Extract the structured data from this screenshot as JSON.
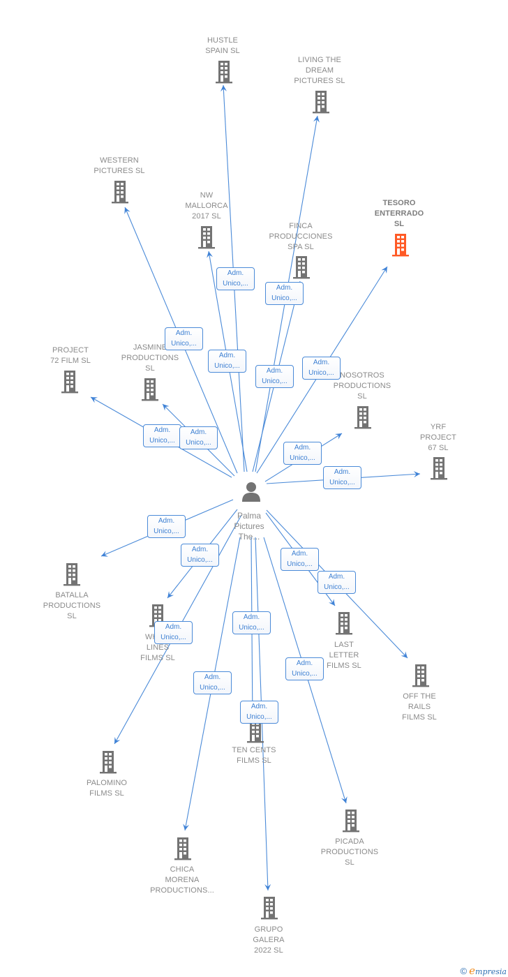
{
  "center": {
    "id": "palma",
    "label": "Palma\nPictures\nThe...",
    "icon": "person-icon"
  },
  "colors": {
    "edge": "#4a8ad8",
    "node": "#737373",
    "highlight": "#ff5a26",
    "label": "#8a8a8a"
  },
  "edge_label": "Adm.\nUnico,...",
  "nodes": [
    {
      "id": "hustle",
      "label": "HUSTLE\nSPAIN  SL",
      "icon": "building-icon",
      "highlight": false
    },
    {
      "id": "living",
      "label": "LIVING THE\nDREAM\nPICTURES  SL",
      "icon": "building-icon",
      "highlight": false
    },
    {
      "id": "western",
      "label": "WESTERN\nPICTURES  SL",
      "icon": "building-icon",
      "highlight": false
    },
    {
      "id": "nw",
      "label": "NW\nMALLORCA\n2017  SL",
      "icon": "building-icon",
      "highlight": false
    },
    {
      "id": "finca",
      "label": "FINCA\nPRODUCCIONES\nSPA  SL",
      "icon": "building-icon",
      "highlight": false
    },
    {
      "id": "tesoro",
      "label": "TESORO\nENTERRADO\nSL",
      "icon": "building-icon",
      "highlight": true
    },
    {
      "id": "project72",
      "label": "PROJECT\n72 FILM  SL",
      "icon": "building-icon",
      "highlight": false
    },
    {
      "id": "jasmine",
      "label": "JASMINE\nPRODUCTIONS\nSL",
      "icon": "building-icon",
      "highlight": false
    },
    {
      "id": "nosotros",
      "label": "NOSOTROS\nPRODUCTIONS\nSL",
      "icon": "building-icon",
      "highlight": false
    },
    {
      "id": "yrf",
      "label": "YRF\nPROJECT\n67  SL",
      "icon": "building-icon",
      "highlight": false
    },
    {
      "id": "batalla",
      "label": "BATALLA\nPRODUCTIONS\nSL",
      "icon": "building-icon",
      "highlight": false
    },
    {
      "id": "white",
      "label": "WHITE\nLINES\nFILMS  SL",
      "icon": "building-icon",
      "highlight": false
    },
    {
      "id": "last",
      "label": "LAST\nLETTER\nFILMS  SL",
      "icon": "building-icon",
      "highlight": false
    },
    {
      "id": "offrails",
      "label": "OFF THE\nRAILS\nFILMS  SL",
      "icon": "building-icon",
      "highlight": false
    },
    {
      "id": "tencents",
      "label": "TEN CENTS\nFILMS  SL",
      "icon": "building-icon",
      "highlight": false
    },
    {
      "id": "palomino",
      "label": "PALOMINO\nFILMS  SL",
      "icon": "building-icon",
      "highlight": false
    },
    {
      "id": "picada",
      "label": "PICADA\nPRODUCTIONS\nSL",
      "icon": "building-icon",
      "highlight": false
    },
    {
      "id": "chica",
      "label": "CHICA\nMORENA\nPRODUCTIONS...",
      "icon": "building-icon",
      "highlight": false
    },
    {
      "id": "grupo",
      "label": "GRUPO\nGALERA\n2022  SL",
      "icon": "building-icon",
      "highlight": false
    }
  ],
  "edges": [
    {
      "from": "palma",
      "to": "hustle",
      "label": "Adm.\nUnico,..."
    },
    {
      "from": "palma",
      "to": "living",
      "label": "Adm.\nUnico,..."
    },
    {
      "from": "palma",
      "to": "western",
      "label": "Adm.\nUnico,..."
    },
    {
      "from": "palma",
      "to": "nw",
      "label": "Adm.\nUnico,..."
    },
    {
      "from": "palma",
      "to": "finca",
      "label": "Adm.\nUnico,..."
    },
    {
      "from": "palma",
      "to": "tesoro",
      "label": "Adm.\nUnico,..."
    },
    {
      "from": "palma",
      "to": "project72",
      "label": "Adm.\nUnico,..."
    },
    {
      "from": "palma",
      "to": "jasmine",
      "label": "Adm.\nUnico,..."
    },
    {
      "from": "palma",
      "to": "nosotros",
      "label": "Adm.\nUnico,..."
    },
    {
      "from": "palma",
      "to": "yrf",
      "label": "Adm.\nUnico,..."
    },
    {
      "from": "palma",
      "to": "batalla",
      "label": "Adm.\nUnico,..."
    },
    {
      "from": "palma",
      "to": "white",
      "label": "Adm.\nUnico,..."
    },
    {
      "from": "palma",
      "to": "last",
      "label": "Adm.\nUnico,..."
    },
    {
      "from": "palma",
      "to": "offrails",
      "label": "Adm.\nUnico,..."
    },
    {
      "from": "palma",
      "to": "tencents",
      "label": "Adm.\nUnico,..."
    },
    {
      "from": "palma",
      "to": "palomino",
      "label": "Adm.\nUnico,..."
    },
    {
      "from": "palma",
      "to": "picada",
      "label": "Adm.\nUnico,..."
    },
    {
      "from": "palma",
      "to": "chica",
      "label": "Adm.\nUnico,..."
    },
    {
      "from": "palma",
      "to": "grupo",
      "label": "Adm.\nUnico,..."
    }
  ],
  "footer": {
    "copyright_symbol": "©",
    "brand_initial": "e",
    "brand_rest": "mpresia"
  }
}
